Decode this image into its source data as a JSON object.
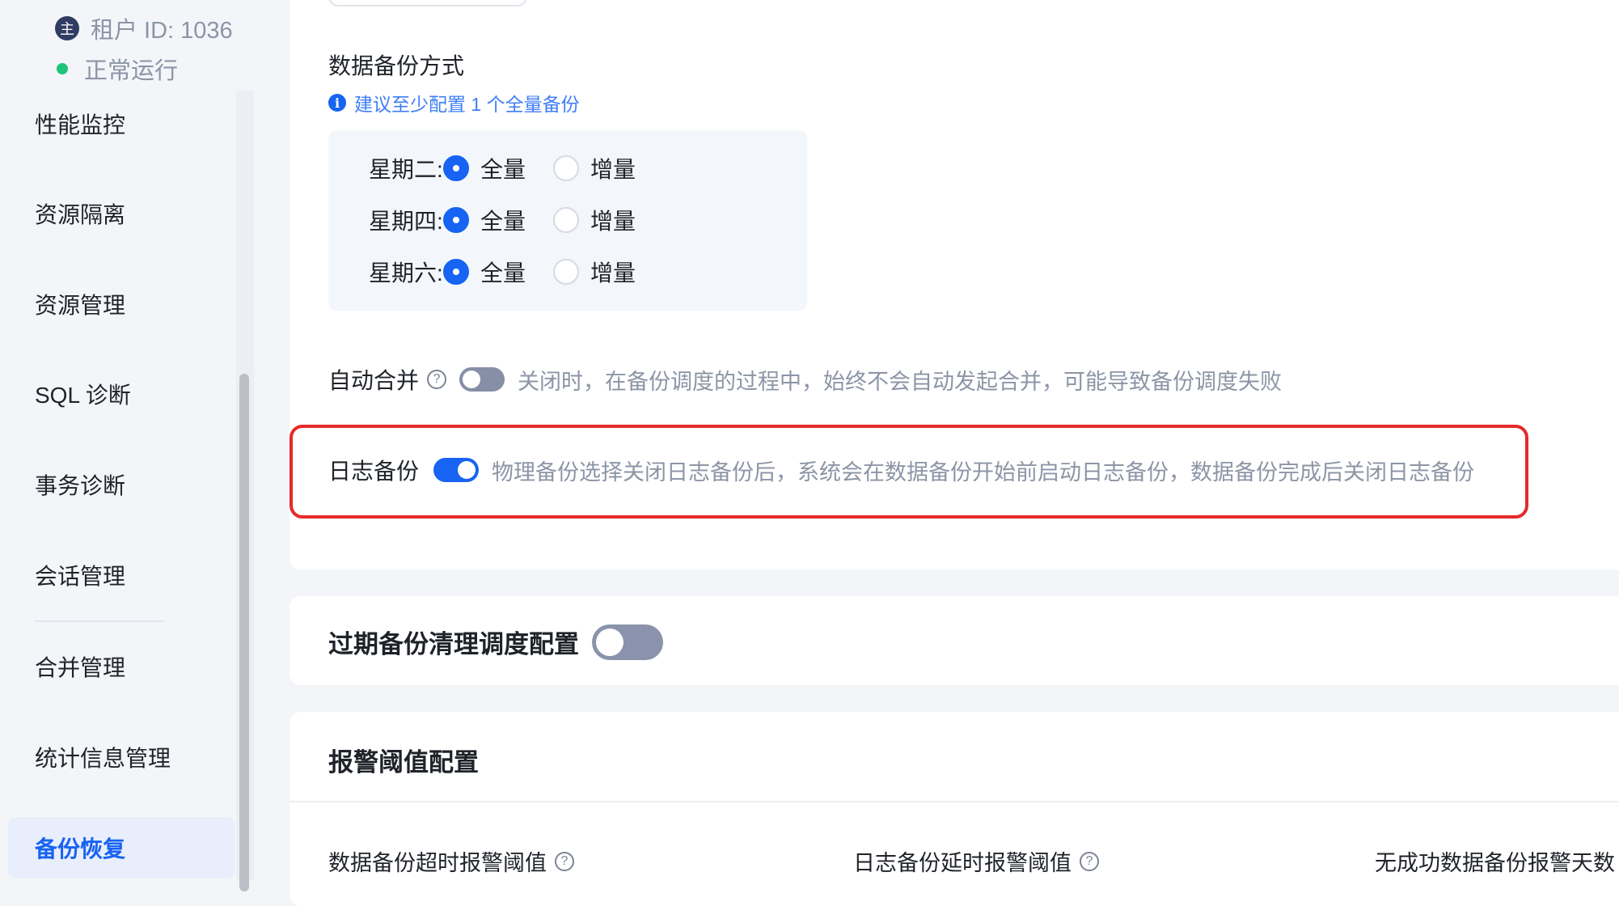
{
  "sidebar": {
    "tenant_icon_char": "主",
    "tenant_label": "租户 ID: 1036",
    "status_label": "正常运行",
    "items": [
      {
        "label": "性能监控"
      },
      {
        "label": "资源隔离"
      },
      {
        "label": "资源管理"
      },
      {
        "label": "SQL 诊断"
      },
      {
        "label": "事务诊断"
      },
      {
        "label": "会话管理"
      },
      {
        "label": "合并管理"
      },
      {
        "label": "统计信息管理"
      },
      {
        "label": "备份恢复",
        "active": true
      }
    ]
  },
  "backup": {
    "method_label": "数据备份方式",
    "hint": "建议至少配置 1 个全量备份",
    "schedule": [
      {
        "day": "星期二:",
        "full": "全量",
        "incremental": "增量",
        "selected": "full"
      },
      {
        "day": "星期四:",
        "full": "全量",
        "incremental": "增量",
        "selected": "full"
      },
      {
        "day": "星期六:",
        "full": "全量",
        "incremental": "增量",
        "selected": "full"
      }
    ],
    "auto_merge": {
      "label": "自动合并",
      "enabled": false,
      "description": "关闭时，在备份调度的过程中，始终不会自动发起合并，可能导致备份调度失败"
    },
    "log_backup": {
      "label": "日志备份",
      "enabled": true,
      "description": "物理备份选择关闭日志备份后，系统会在数据备份开始前启动日志备份，数据备份完成后关闭日志备份"
    }
  },
  "expired_cleanup": {
    "title": "过期备份清理调度配置",
    "enabled": false
  },
  "alert": {
    "title": "报警阈值配置",
    "thresholds": [
      {
        "label": "数据备份超时报警阈值"
      },
      {
        "label": "日志备份延时报警阈值"
      },
      {
        "label": "无成功数据备份报警天数"
      }
    ]
  },
  "colors": {
    "accent": "#1763f2",
    "highlight": "#e52a2a",
    "muted_text": "#8c95a6"
  }
}
